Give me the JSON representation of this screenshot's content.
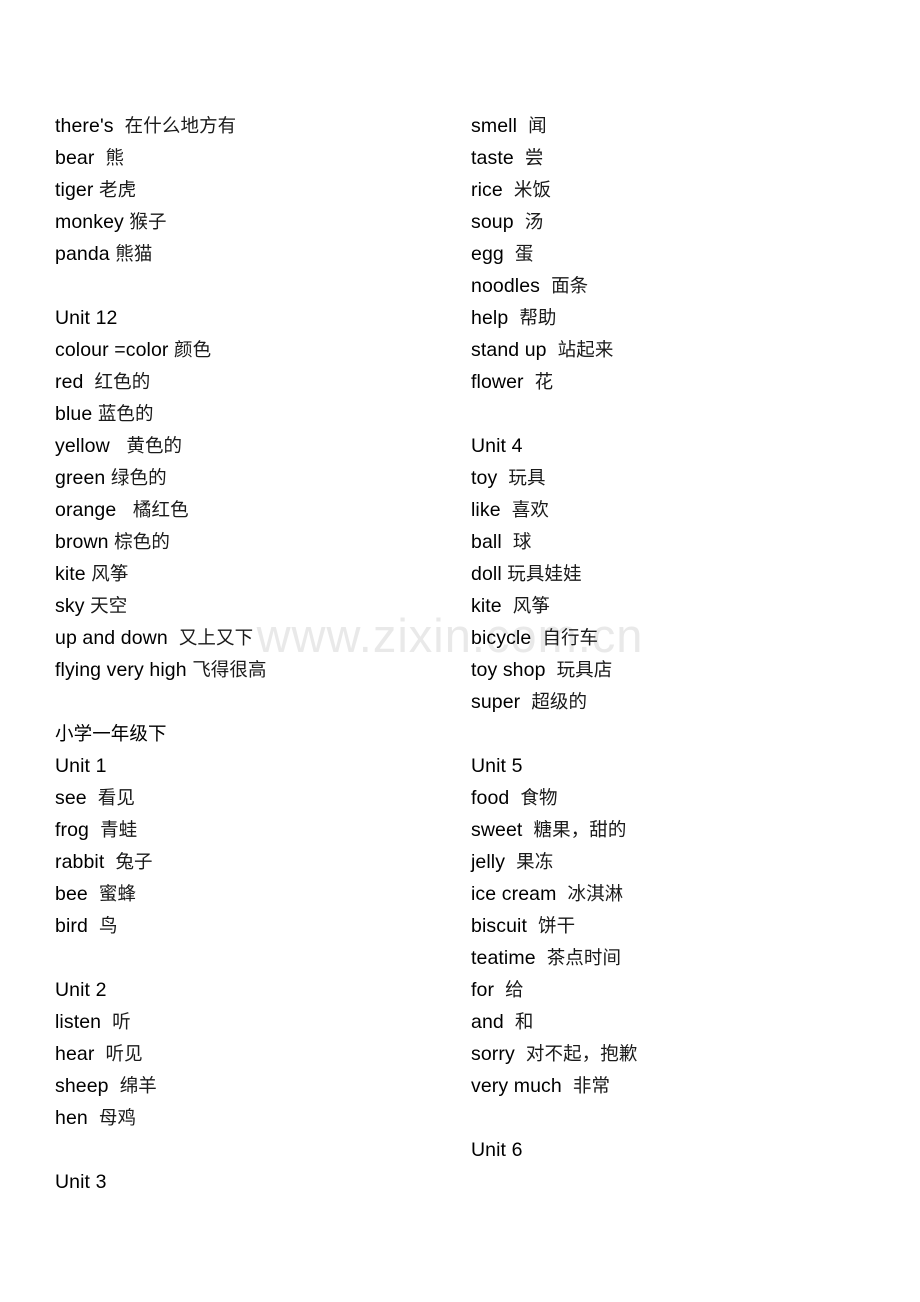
{
  "document": {
    "watermark": "www.zixin.com.cn",
    "page_background": "#ffffff",
    "text_color": "#000000",
    "watermark_color": "#e9e9e9"
  },
  "columns": {
    "left": [
      {
        "kind": "entry",
        "term": "there's",
        "gap": "  ",
        "gloss": "在什么地方有"
      },
      {
        "kind": "entry",
        "term": "bear",
        "gap": "  ",
        "gloss": "熊"
      },
      {
        "kind": "entry",
        "term": "tiger",
        "gap": " ",
        "gloss": "老虎"
      },
      {
        "kind": "entry",
        "term": "monkey",
        "gap": " ",
        "gloss": "猴子"
      },
      {
        "kind": "entry",
        "term": "panda",
        "gap": " ",
        "gloss": "熊猫"
      },
      {
        "kind": "blank"
      },
      {
        "kind": "heading",
        "text": "Unit 12"
      },
      {
        "kind": "entry",
        "term": "colour =color",
        "gap": " ",
        "gloss": "颜色"
      },
      {
        "kind": "entry",
        "term": "red",
        "gap": "  ",
        "gloss": "红色的"
      },
      {
        "kind": "entry",
        "term": "blue",
        "gap": " ",
        "gloss": "蓝色的"
      },
      {
        "kind": "entry",
        "term": "yellow",
        "gap": "   ",
        "gloss": "黄色的"
      },
      {
        "kind": "entry",
        "term": "green",
        "gap": " ",
        "gloss": "绿色的"
      },
      {
        "kind": "entry",
        "term": "orange",
        "gap": "   ",
        "gloss": "橘红色"
      },
      {
        "kind": "entry",
        "term": "brown",
        "gap": " ",
        "gloss": "棕色的"
      },
      {
        "kind": "entry",
        "term": "kite",
        "gap": " ",
        "gloss": "风筝"
      },
      {
        "kind": "entry",
        "term": "sky",
        "gap": " ",
        "gloss": "天空"
      },
      {
        "kind": "entry",
        "term": "up and down",
        "gap": "  ",
        "gloss": "又上又下"
      },
      {
        "kind": "entry",
        "term": "flying very high",
        "gap": " ",
        "gloss": "飞得很高"
      },
      {
        "kind": "blank"
      },
      {
        "kind": "heading",
        "text": "小学一年级下",
        "cjk": true
      },
      {
        "kind": "heading",
        "text": "Unit 1"
      },
      {
        "kind": "entry",
        "term": "see",
        "gap": "  ",
        "gloss": "看见"
      },
      {
        "kind": "entry",
        "term": "frog",
        "gap": "  ",
        "gloss": "青蛙"
      },
      {
        "kind": "entry",
        "term": "rabbit",
        "gap": "  ",
        "gloss": "兔子"
      },
      {
        "kind": "entry",
        "term": "bee",
        "gap": "  ",
        "gloss": "蜜蜂"
      },
      {
        "kind": "entry",
        "term": "bird",
        "gap": "  ",
        "gloss": "鸟"
      },
      {
        "kind": "blank"
      },
      {
        "kind": "heading",
        "text": "Unit 2"
      },
      {
        "kind": "entry",
        "term": "listen",
        "gap": "  ",
        "gloss": "听"
      },
      {
        "kind": "entry",
        "term": "hear",
        "gap": "  ",
        "gloss": "听见"
      },
      {
        "kind": "entry",
        "term": "sheep",
        "gap": "  ",
        "gloss": "绵羊"
      },
      {
        "kind": "entry",
        "term": "hen",
        "gap": "  ",
        "gloss": "母鸡"
      },
      {
        "kind": "blank"
      },
      {
        "kind": "heading",
        "text": "Unit 3"
      }
    ],
    "right": [
      {
        "kind": "entry",
        "term": "smell",
        "gap": "  ",
        "gloss": "闻"
      },
      {
        "kind": "entry",
        "term": "taste",
        "gap": "  ",
        "gloss": "尝"
      },
      {
        "kind": "entry",
        "term": "rice",
        "gap": "  ",
        "gloss": "米饭"
      },
      {
        "kind": "entry",
        "term": "soup",
        "gap": "  ",
        "gloss": "汤"
      },
      {
        "kind": "entry",
        "term": "egg",
        "gap": "  ",
        "gloss": "蛋"
      },
      {
        "kind": "entry",
        "term": "noodles",
        "gap": "  ",
        "gloss": "面条"
      },
      {
        "kind": "entry",
        "term": "help",
        "gap": "  ",
        "gloss": "帮助"
      },
      {
        "kind": "entry",
        "term": "stand up",
        "gap": "  ",
        "gloss": "站起来"
      },
      {
        "kind": "entry",
        "term": "flower",
        "gap": "  ",
        "gloss": "花"
      },
      {
        "kind": "blank"
      },
      {
        "kind": "heading",
        "text": "Unit 4"
      },
      {
        "kind": "entry",
        "term": "toy",
        "gap": "  ",
        "gloss": "玩具"
      },
      {
        "kind": "entry",
        "term": "like",
        "gap": "  ",
        "gloss": "喜欢"
      },
      {
        "kind": "entry",
        "term": "ball",
        "gap": "  ",
        "gloss": "球"
      },
      {
        "kind": "entry",
        "term": "doll",
        "gap": " ",
        "gloss": "玩具娃娃"
      },
      {
        "kind": "entry",
        "term": "kite",
        "gap": "  ",
        "gloss": "风筝"
      },
      {
        "kind": "entry",
        "term": "bicycle",
        "gap": "  ",
        "gloss": "自行车"
      },
      {
        "kind": "entry",
        "term": "toy shop",
        "gap": "  ",
        "gloss": "玩具店"
      },
      {
        "kind": "entry",
        "term": "super",
        "gap": "  ",
        "gloss": "超级的"
      },
      {
        "kind": "blank"
      },
      {
        "kind": "heading",
        "text": "Unit 5"
      },
      {
        "kind": "entry",
        "term": "food",
        "gap": "  ",
        "gloss": "食物"
      },
      {
        "kind": "entry",
        "term": "sweet",
        "gap": "  ",
        "gloss": "糖果，甜的"
      },
      {
        "kind": "entry",
        "term": "jelly",
        "gap": "  ",
        "gloss": "果冻"
      },
      {
        "kind": "entry",
        "term": "ice cream",
        "gap": "  ",
        "gloss": "冰淇淋"
      },
      {
        "kind": "entry",
        "term": "biscuit",
        "gap": "  ",
        "gloss": "饼干"
      },
      {
        "kind": "entry",
        "term": "teatime",
        "gap": "  ",
        "gloss": "茶点时间"
      },
      {
        "kind": "entry",
        "term": "for",
        "gap": "  ",
        "gloss": "给"
      },
      {
        "kind": "entry",
        "term": "and",
        "gap": "  ",
        "gloss": "和"
      },
      {
        "kind": "entry",
        "term": "sorry",
        "gap": "  ",
        "gloss": "对不起，抱歉"
      },
      {
        "kind": "entry",
        "term": "very much",
        "gap": "  ",
        "gloss": "非常"
      },
      {
        "kind": "blank"
      },
      {
        "kind": "heading",
        "text": "Unit 6"
      }
    ]
  }
}
